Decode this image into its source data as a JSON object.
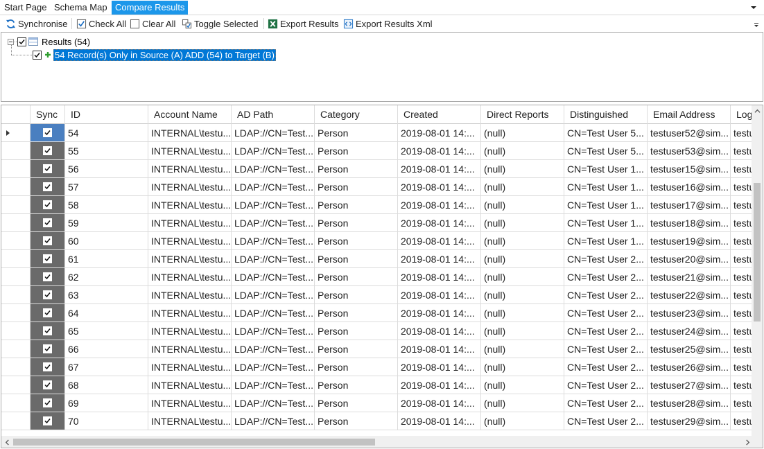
{
  "tabs": [
    {
      "label": "Start Page",
      "active": false
    },
    {
      "label": "Schema Map",
      "active": false
    },
    {
      "label": "Compare Results",
      "active": true
    }
  ],
  "toolbar": {
    "synchronise": "Synchronise",
    "check_all": "Check All",
    "clear_all": "Clear All",
    "toggle_selected": "Toggle Selected",
    "export_results": "Export Results",
    "export_results_xml": "Export Results Xml"
  },
  "tree": {
    "root_label": "Results (54)",
    "child_label": "54 Record(s) Only in Source (A) ADD (54) to Target (B)"
  },
  "grid": {
    "columns": [
      "Sync",
      "ID",
      "Account Name",
      "AD Path",
      "Category",
      "Created",
      "Direct Reports",
      "Distinguished",
      "Email Address",
      "Logo"
    ],
    "rows": [
      {
        "id": "54",
        "account": "INTERNAL\\testu...",
        "adpath": "LDAP://CN=Test...",
        "category": "Person",
        "created": "2019-08-01 14:...",
        "direct": "(null)",
        "dn": "CN=Test User 5...",
        "email": "testuser52@sim...",
        "logo": "testu"
      },
      {
        "id": "55",
        "account": "INTERNAL\\testu...",
        "adpath": "LDAP://CN=Test...",
        "category": "Person",
        "created": "2019-08-01 14:...",
        "direct": "(null)",
        "dn": "CN=Test User 5...",
        "email": "testuser53@sim...",
        "logo": "testu"
      },
      {
        "id": "56",
        "account": "INTERNAL\\testu...",
        "adpath": "LDAP://CN=Test...",
        "category": "Person",
        "created": "2019-08-01 14:...",
        "direct": "(null)",
        "dn": "CN=Test User 1...",
        "email": "testuser15@sim...",
        "logo": "testu"
      },
      {
        "id": "57",
        "account": "INTERNAL\\testu...",
        "adpath": "LDAP://CN=Test...",
        "category": "Person",
        "created": "2019-08-01 14:...",
        "direct": "(null)",
        "dn": "CN=Test User 1...",
        "email": "testuser16@sim...",
        "logo": "testu"
      },
      {
        "id": "58",
        "account": "INTERNAL\\testu...",
        "adpath": "LDAP://CN=Test...",
        "category": "Person",
        "created": "2019-08-01 14:...",
        "direct": "(null)",
        "dn": "CN=Test User 1...",
        "email": "testuser17@sim...",
        "logo": "testu"
      },
      {
        "id": "59",
        "account": "INTERNAL\\testu...",
        "adpath": "LDAP://CN=Test...",
        "category": "Person",
        "created": "2019-08-01 14:...",
        "direct": "(null)",
        "dn": "CN=Test User 1...",
        "email": "testuser18@sim...",
        "logo": "testu"
      },
      {
        "id": "60",
        "account": "INTERNAL\\testu...",
        "adpath": "LDAP://CN=Test...",
        "category": "Person",
        "created": "2019-08-01 14:...",
        "direct": "(null)",
        "dn": "CN=Test User 1...",
        "email": "testuser19@sim...",
        "logo": "testu"
      },
      {
        "id": "61",
        "account": "INTERNAL\\testu...",
        "adpath": "LDAP://CN=Test...",
        "category": "Person",
        "created": "2019-08-01 14:...",
        "direct": "(null)",
        "dn": "CN=Test User 2...",
        "email": "testuser20@sim...",
        "logo": "testu"
      },
      {
        "id": "62",
        "account": "INTERNAL\\testu...",
        "adpath": "LDAP://CN=Test...",
        "category": "Person",
        "created": "2019-08-01 14:...",
        "direct": "(null)",
        "dn": "CN=Test User 2...",
        "email": "testuser21@sim...",
        "logo": "testu"
      },
      {
        "id": "63",
        "account": "INTERNAL\\testu...",
        "adpath": "LDAP://CN=Test...",
        "category": "Person",
        "created": "2019-08-01 14:...",
        "direct": "(null)",
        "dn": "CN=Test User 2...",
        "email": "testuser22@sim...",
        "logo": "testu"
      },
      {
        "id": "64",
        "account": "INTERNAL\\testu...",
        "adpath": "LDAP://CN=Test...",
        "category": "Person",
        "created": "2019-08-01 14:...",
        "direct": "(null)",
        "dn": "CN=Test User 2...",
        "email": "testuser23@sim...",
        "logo": "testu"
      },
      {
        "id": "65",
        "account": "INTERNAL\\testu...",
        "adpath": "LDAP://CN=Test...",
        "category": "Person",
        "created": "2019-08-01 14:...",
        "direct": "(null)",
        "dn": "CN=Test User 2...",
        "email": "testuser24@sim...",
        "logo": "testu"
      },
      {
        "id": "66",
        "account": "INTERNAL\\testu...",
        "adpath": "LDAP://CN=Test...",
        "category": "Person",
        "created": "2019-08-01 14:...",
        "direct": "(null)",
        "dn": "CN=Test User 2...",
        "email": "testuser25@sim...",
        "logo": "testu"
      },
      {
        "id": "67",
        "account": "INTERNAL\\testu...",
        "adpath": "LDAP://CN=Test...",
        "category": "Person",
        "created": "2019-08-01 14:...",
        "direct": "(null)",
        "dn": "CN=Test User 2...",
        "email": "testuser26@sim...",
        "logo": "testu"
      },
      {
        "id": "68",
        "account": "INTERNAL\\testu...",
        "adpath": "LDAP://CN=Test...",
        "category": "Person",
        "created": "2019-08-01 14:...",
        "direct": "(null)",
        "dn": "CN=Test User 2...",
        "email": "testuser27@sim...",
        "logo": "testu"
      },
      {
        "id": "69",
        "account": "INTERNAL\\testu...",
        "adpath": "LDAP://CN=Test...",
        "category": "Person",
        "created": "2019-08-01 14:...",
        "direct": "(null)",
        "dn": "CN=Test User 2...",
        "email": "testuser28@sim...",
        "logo": "testu"
      },
      {
        "id": "70",
        "account": "INTERNAL\\testu...",
        "adpath": "LDAP://CN=Test...",
        "category": "Person",
        "created": "2019-08-01 14:...",
        "direct": "(null)",
        "dn": "CN=Test User 2...",
        "email": "testuser29@sim...",
        "logo": "testu"
      }
    ]
  },
  "colors": {
    "accent": "#1c97ea",
    "selection": "#0078d7",
    "sync_column": "#6a6a6a",
    "add_icon": "#2e9e2e"
  }
}
